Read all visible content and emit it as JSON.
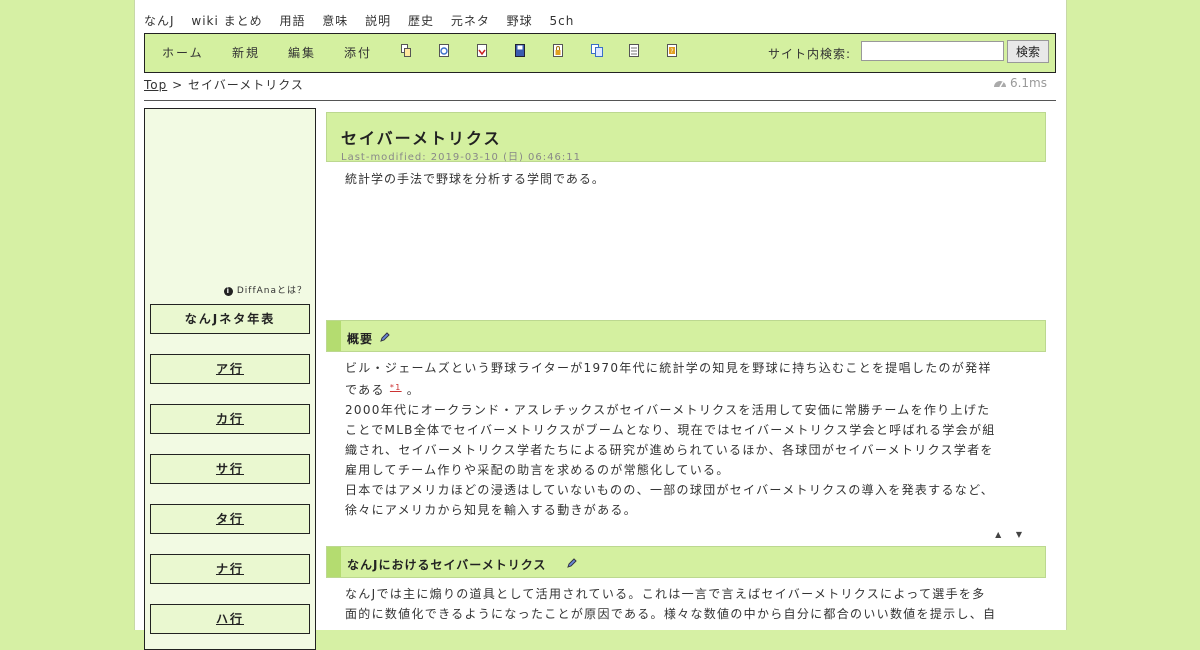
{
  "topnav": [
    "なんJ",
    "wiki まとめ",
    "用語",
    "意味",
    "説明",
    "歴史",
    "元ネタ",
    "野球",
    "5ch"
  ],
  "toolbar": {
    "buttons": [
      "ホーム",
      "新規",
      "編集",
      "添付"
    ],
    "icons": [
      "copy-icon",
      "refresh-icon",
      "diff-icon",
      "backup-icon",
      "lock-icon",
      "duplicate-icon",
      "list-icon",
      "help-icon"
    ],
    "search_label": "サイト内検索:",
    "search_value": "",
    "search_button": "検索"
  },
  "breadcrumb": {
    "top": "Top",
    "sep": ">",
    "current": "セイバーメトリクス"
  },
  "timing": "6.1ms",
  "sidebar": {
    "diffana": "DiffAnaとは？",
    "items": [
      "なんJネタ年表",
      "ア行",
      "カ行",
      "サ行",
      "タ行",
      "ナ行",
      "ハ行"
    ]
  },
  "page": {
    "title": "セイバーメトリクス",
    "last_modified": "Last-modified: 2019-03-10 (日) 06:46:11",
    "intro": "統計学の手法で野球を分析する学問である。",
    "sections": [
      {
        "heading": "概要",
        "lines": [
          "ビル・ジェームズという野球ライターが1970年代に統計学の知見を野球に持ち込むことを提唱したのが発祥",
          "である",
          "*1",
          "。",
          "2000年代にオークランド・アスレチックスがセイバーメトリクスを活用して安価に常勝チームを作り上げた",
          "ことでMLB全体でセイバーメトリクスがブームとなり、現在ではセイバーメトリクス学会と呼ばれる学会が組",
          "織され、セイバーメトリクス学者たちによる研究が進められているほか、各球団がセイバーメトリクス学者を",
          "雇用してチーム作りや采配の助言を求めるのが常態化している。",
          "日本ではアメリカほどの浸透はしていないものの、一部の球団がセイバーメトリクスの導入を発表するなど、",
          "徐々にアメリカから知見を輸入する動きがある。"
        ]
      },
      {
        "heading": "なんJにおけるセイバーメトリクス",
        "lines": [
          "なんJでは主に煽りの道具として活用されている。これは一言で言えばセイバーメトリクスによって選手を多",
          "面的に数値化できるようになったことが原因である。様々な数値の中から自分に都合のいい数値を提示し、自"
        ]
      }
    ],
    "arrows": "▲ ▼"
  }
}
